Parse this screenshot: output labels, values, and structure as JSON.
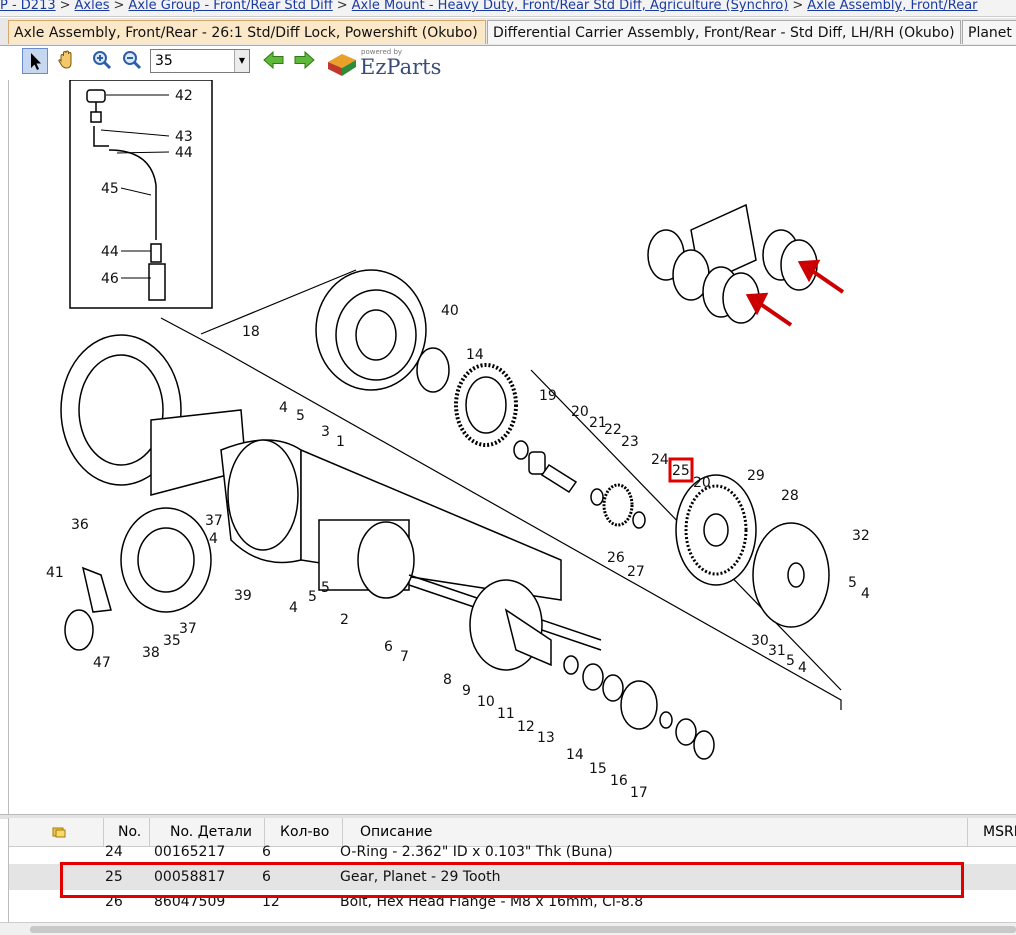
{
  "breadcrumb": [
    "P - D213",
    "Axles",
    "Axle Group - Front/Rear Std Diff",
    "Axle Mount - Heavy Duty, Front/Rear Std Diff, Agriculture (Synchro)",
    "Axle Assembly, Front/Rear"
  ],
  "breadcrumb_sep": ">",
  "tabs": [
    "Axle Assembly, Front/Rear - 26:1 Std/Diff Lock, Powershift (Okubo)",
    "Differential Carrier Assembly, Front/Rear - Std Diff, LH/RH (Okubo)",
    "Planet C"
  ],
  "toolbar": {
    "zoom_value": "35",
    "dropdown_glyph": "▼",
    "logo_powered": "powered by",
    "logo_text": "EzParts"
  },
  "icons": [
    "pointer-icon",
    "hand-icon",
    "zoom-in-icon",
    "zoom-out-icon",
    "back-arrow-icon",
    "forward-arrow-icon",
    "ezparts-logo-icon",
    "attachment-icon"
  ],
  "diagram": {
    "callouts": [
      "42",
      "43",
      "44",
      "45",
      "44",
      "46",
      "40",
      "18",
      "14",
      "19",
      "20",
      "21",
      "22",
      "23",
      "24",
      "25",
      "20",
      "29",
      "28",
      "32",
      "4",
      "5",
      "3",
      "1",
      "36",
      "37",
      "4",
      "41",
      "39",
      "5",
      "4",
      "5",
      "2",
      "26",
      "27",
      "5",
      "4",
      "30",
      "31",
      "5",
      "4",
      "6",
      "7",
      "37",
      "35",
      "38",
      "47",
      "8",
      "9",
      "10",
      "11",
      "12",
      "13",
      "14",
      "15",
      "16",
      "17"
    ],
    "highlight_callout": "25"
  },
  "grid": {
    "columns": [
      "No.",
      "No. Детали",
      "Кол-во",
      "Описание",
      "MSRP"
    ],
    "rows": [
      {
        "no": "24",
        "part": "00165217",
        "qty": "6",
        "desc": "O-Ring - 2.362\" ID x 0.103\" Thk (Buna)"
      },
      {
        "no": "25",
        "part": "00058817",
        "qty": "6",
        "desc": "Gear, Planet - 29 Tooth"
      },
      {
        "no": "26",
        "part": "86047509",
        "qty": "12",
        "desc": "Bolt, Hex Head Flange - M8 x 16mm, Cl-8.8"
      }
    ]
  },
  "colors": {
    "highlight": "#e00000",
    "active_tab": "#fbe8c8",
    "selected_row": "#e4e4e4"
  }
}
